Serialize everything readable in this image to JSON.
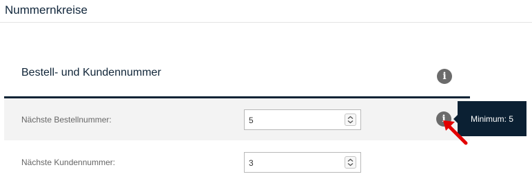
{
  "header": {
    "title": "Nummernkreise"
  },
  "section": {
    "title": "Bestell- und Kundennummer",
    "info_glyph": "i"
  },
  "rows": [
    {
      "label": "Nächste Bestellnummer:",
      "value": "5",
      "info_glyph": "i"
    },
    {
      "label": "Nächste Kundennummer:",
      "value": "3"
    }
  ],
  "tooltip": {
    "text": "Minimum: 5"
  },
  "colors": {
    "accent": "#0b2033",
    "info_icon": "#6b6b6b",
    "annotation_arrow": "#e30000"
  }
}
